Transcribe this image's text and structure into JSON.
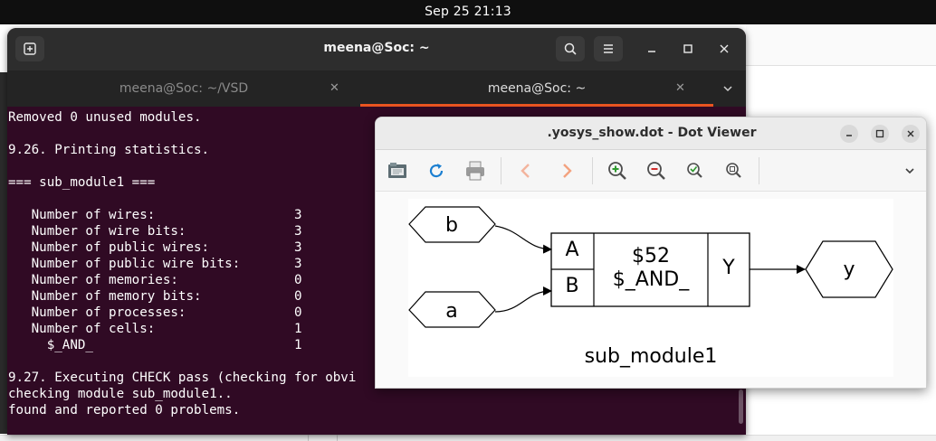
{
  "topbar": {
    "clock": "Sep 25  21:13"
  },
  "terminal": {
    "title": "meena@Soc: ~",
    "tabs": [
      {
        "label": "meena@Soc: ~/VSD",
        "close": "✕"
      },
      {
        "label": "meena@Soc: ~",
        "close": "✕"
      }
    ],
    "lines": [
      "Removed 0 unused modules.",
      "",
      "9.26. Printing statistics.",
      "",
      "=== sub_module1 ===",
      "",
      "   Number of wires:                  3",
      "   Number of wire bits:              3",
      "   Number of public wires:           3",
      "   Number of public wire bits:       3",
      "   Number of memories:               0",
      "   Number of memory bits:            0",
      "   Number of processes:              0",
      "   Number of cells:                  1",
      "     $_AND_                          1",
      "",
      "9.27. Executing CHECK pass (checking for obvi",
      "checking module sub_module1..",
      "found and reported 0 problems."
    ]
  },
  "dotviewer": {
    "title": ".yosys_show.dot - Dot Viewer",
    "graph": {
      "inputs": [
        "b",
        "a"
      ],
      "output": "y",
      "cell": {
        "port_a": "A",
        "port_b": "B",
        "id": "$52",
        "type": "$_AND_",
        "port_y": "Y"
      },
      "label": "sub_module1"
    }
  }
}
